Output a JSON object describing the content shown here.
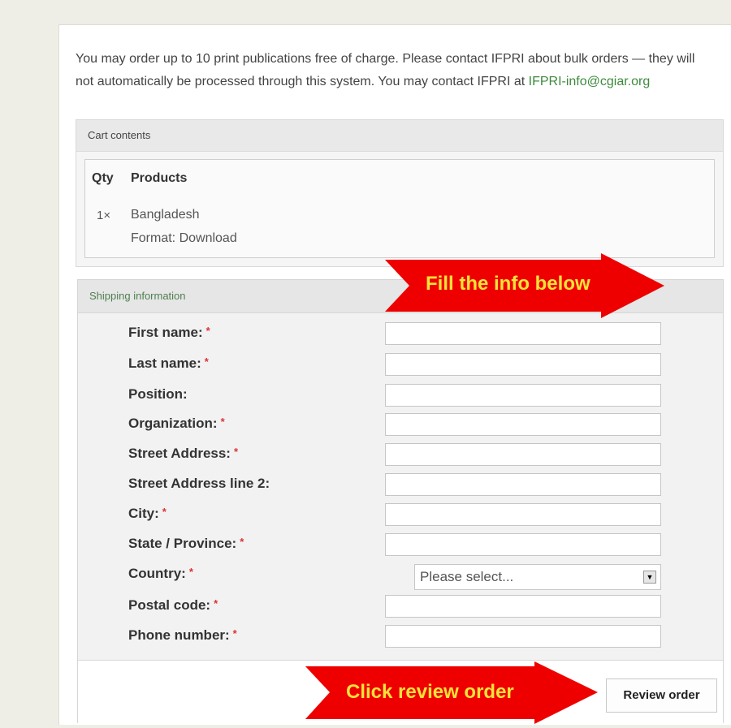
{
  "intro": {
    "text": "You may order up to 10 print publications free of charge. Please contact IFPRI about bulk orders — they will not automatically be processed through this system. You may contact IFPRI at ",
    "email": "IFPRI-info@cgiar.org"
  },
  "cart": {
    "legend": "Cart contents",
    "col_qty": "Qty",
    "col_products": "Products",
    "items": [
      {
        "qty": "1×",
        "name": "Bangladesh",
        "format": "Format: Download"
      }
    ]
  },
  "shipping": {
    "legend": "Shipping information",
    "required_mark": "*",
    "fields": [
      {
        "label": "First name:",
        "required": true,
        "value": ""
      },
      {
        "label": "Last name:",
        "required": true,
        "value": ""
      },
      {
        "label": "Position:",
        "required": false,
        "value": ""
      },
      {
        "label": "Organization:",
        "required": true,
        "value": ""
      },
      {
        "label": "Street Address:",
        "required": true,
        "value": ""
      },
      {
        "label": "Street Address line 2:",
        "required": false,
        "value": ""
      },
      {
        "label": "City:",
        "required": true,
        "value": ""
      },
      {
        "label": "State / Province:",
        "required": true,
        "value": ""
      },
      {
        "label": "Country:",
        "required": true,
        "value": ""
      },
      {
        "label": "Postal code:",
        "required": true,
        "value": ""
      },
      {
        "label": "Phone number:",
        "required": true,
        "value": ""
      }
    ],
    "country_select": "Please select...",
    "review_button": "Review order"
  },
  "annotations": {
    "fill_info": "Fill the info below",
    "click_review": "Click review order",
    "arrow_color": "#ee0000",
    "arrow_text_color": "#ffe23b"
  }
}
